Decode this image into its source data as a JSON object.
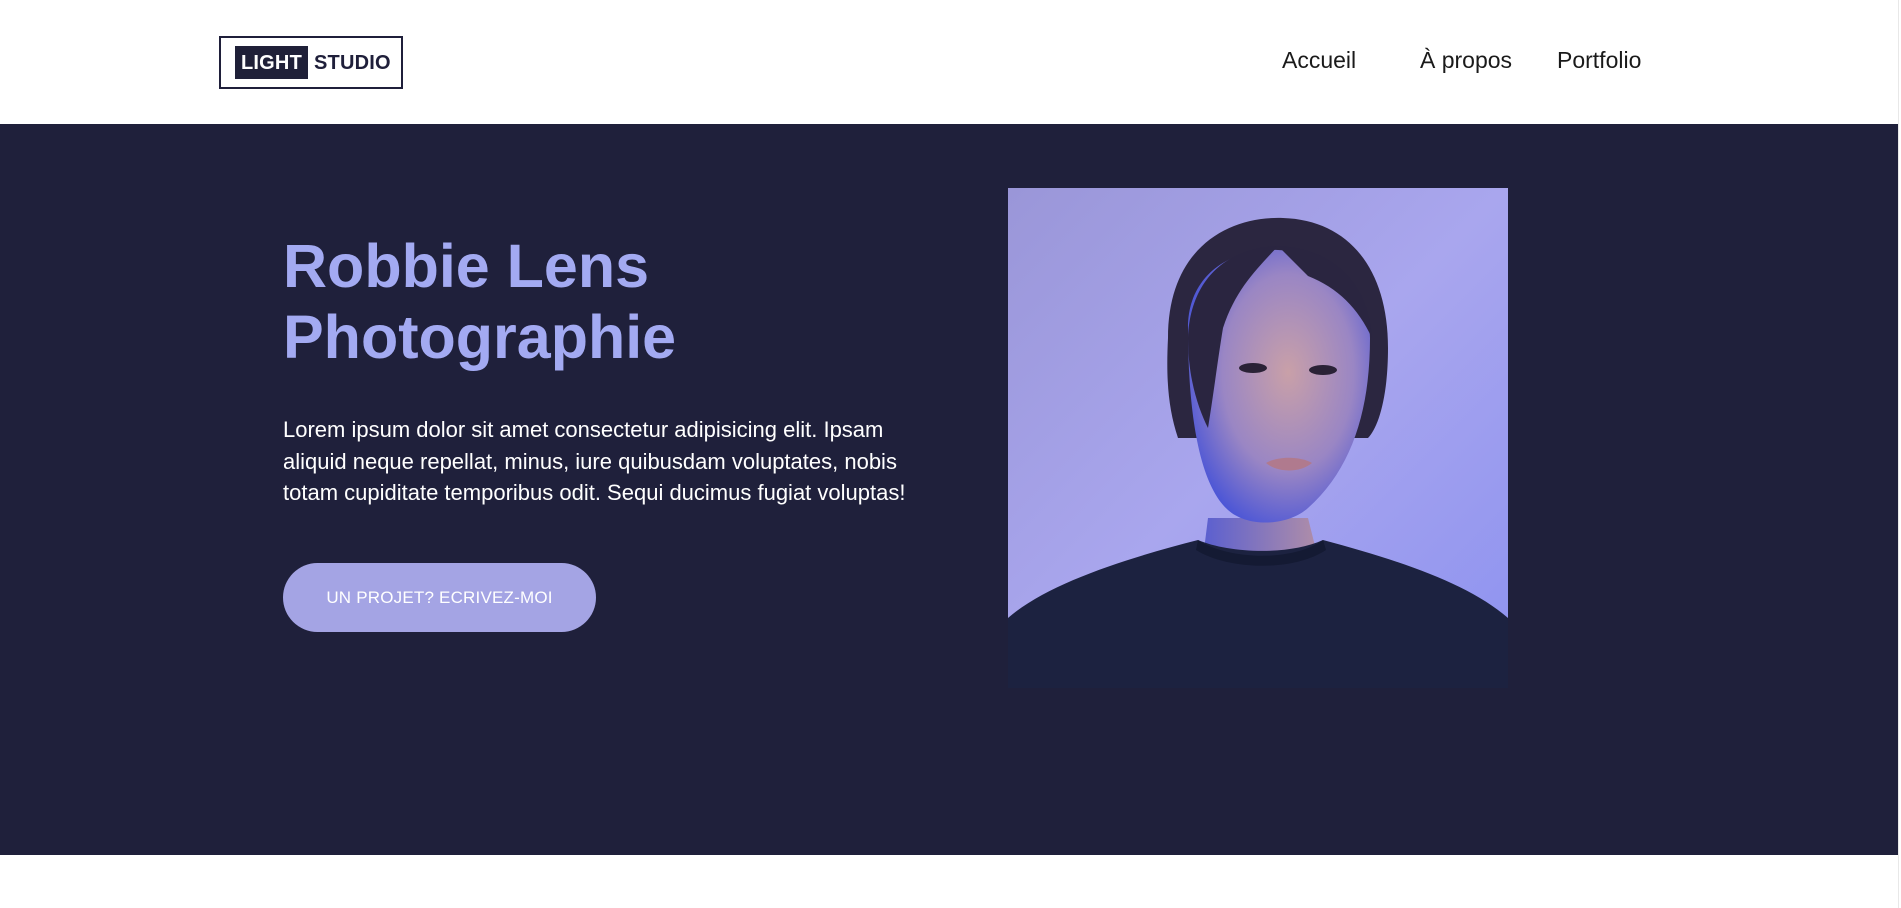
{
  "header": {
    "logo": {
      "part1": "LIGHT",
      "part2": "STUDIO"
    },
    "nav": [
      {
        "label": "Accueil"
      },
      {
        "label": "À propos"
      },
      {
        "label": "Portfolio"
      }
    ]
  },
  "hero": {
    "title_line1": "Robbie Lens",
    "title_line2": "Photographie",
    "text": "Lorem ipsum dolor sit amet consectetur adipisicing elit. Ipsam aliquid neque repellat, minus, iure quibusdam voluptates, nobis totam cupiditate temporibus odit. Sequi ducimus fugiat voluptas!",
    "cta_label": "UN PROJET? ECRIVEZ-MOI",
    "image_icon": "portrait-photo"
  },
  "colors": {
    "hero_bg": "#1f203b",
    "title": "#a3aaf2",
    "button": "#a4a4e4",
    "logo_dark": "#1f2038"
  }
}
